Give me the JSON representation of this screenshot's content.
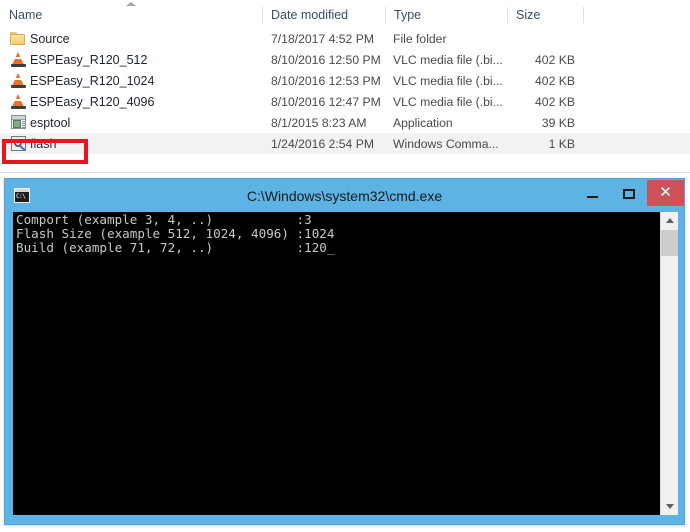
{
  "explorer": {
    "columns": [
      {
        "label": "Name",
        "key": "name"
      },
      {
        "label": "Date modified",
        "key": "date"
      },
      {
        "label": "Type",
        "key": "type"
      },
      {
        "label": "Size",
        "key": "size"
      }
    ],
    "sort": {
      "column": "Name",
      "direction": "ascending",
      "icon": "sort-ascending-arrow-icon"
    },
    "rows": [
      {
        "name": "Source",
        "date": "7/18/2017 4:52 PM",
        "type": "File folder",
        "size": "",
        "icon": "folder-icon",
        "selected": false
      },
      {
        "name": "ESPEasy_R120_512",
        "date": "8/10/2016 12:50 PM",
        "type": "VLC media file (.bi...",
        "size": "402 KB",
        "icon": "vlc-cone-icon",
        "selected": false
      },
      {
        "name": "ESPEasy_R120_1024",
        "date": "8/10/2016 12:53 PM",
        "type": "VLC media file (.bi...",
        "size": "402 KB",
        "icon": "vlc-cone-icon",
        "selected": false
      },
      {
        "name": "ESPEasy_R120_4096",
        "date": "8/10/2016 12:47 PM",
        "type": "VLC media file (.bi...",
        "size": "402 KB",
        "icon": "vlc-cone-icon",
        "selected": false
      },
      {
        "name": "esptool",
        "date": "8/1/2015 8:23 AM",
        "type": "Application",
        "size": "39 KB",
        "icon": "application-exe-icon",
        "selected": false
      },
      {
        "name": "flash",
        "date": "1/24/2016 2:54 PM",
        "type": "Windows Comma...",
        "size": "1 KB",
        "icon": "batch-script-icon",
        "selected": true
      }
    ],
    "highlight": {
      "target": "flash",
      "color": "#e8151f",
      "shape": "rectangle-annotation"
    }
  },
  "cmd_window": {
    "title": "C:\\Windows\\system32\\cmd.exe",
    "title_icon": "cmd-console-icon",
    "titlebar_color": "#5cb3e4",
    "close_button_color": "#cf5158",
    "buttons": {
      "minimize": {
        "label": "–",
        "icon": "minimize-icon"
      },
      "maximize": {
        "label": "□",
        "icon": "maximize-icon"
      },
      "close": {
        "label": "✕",
        "icon": "close-icon"
      }
    },
    "console": {
      "background": "#000000",
      "foreground": "#c8c8c8",
      "lines": [
        "Comport (example 3, 4, ..)           :3",
        "Flash Size (example 512, 1024, 4096) :1024",
        "Build (example 71, 72, ..)           :120_"
      ],
      "text": "Comport (example 3, 4, ..)           :3\nFlash Size (example 512, 1024, 4096) :1024\nBuild (example 71, 72, ..)           :120_"
    },
    "scrollbar": {
      "up_arrow": "scroll-up-arrow-icon",
      "down_arrow": "scroll-down-arrow-icon",
      "thumb_position": "near-top"
    }
  }
}
